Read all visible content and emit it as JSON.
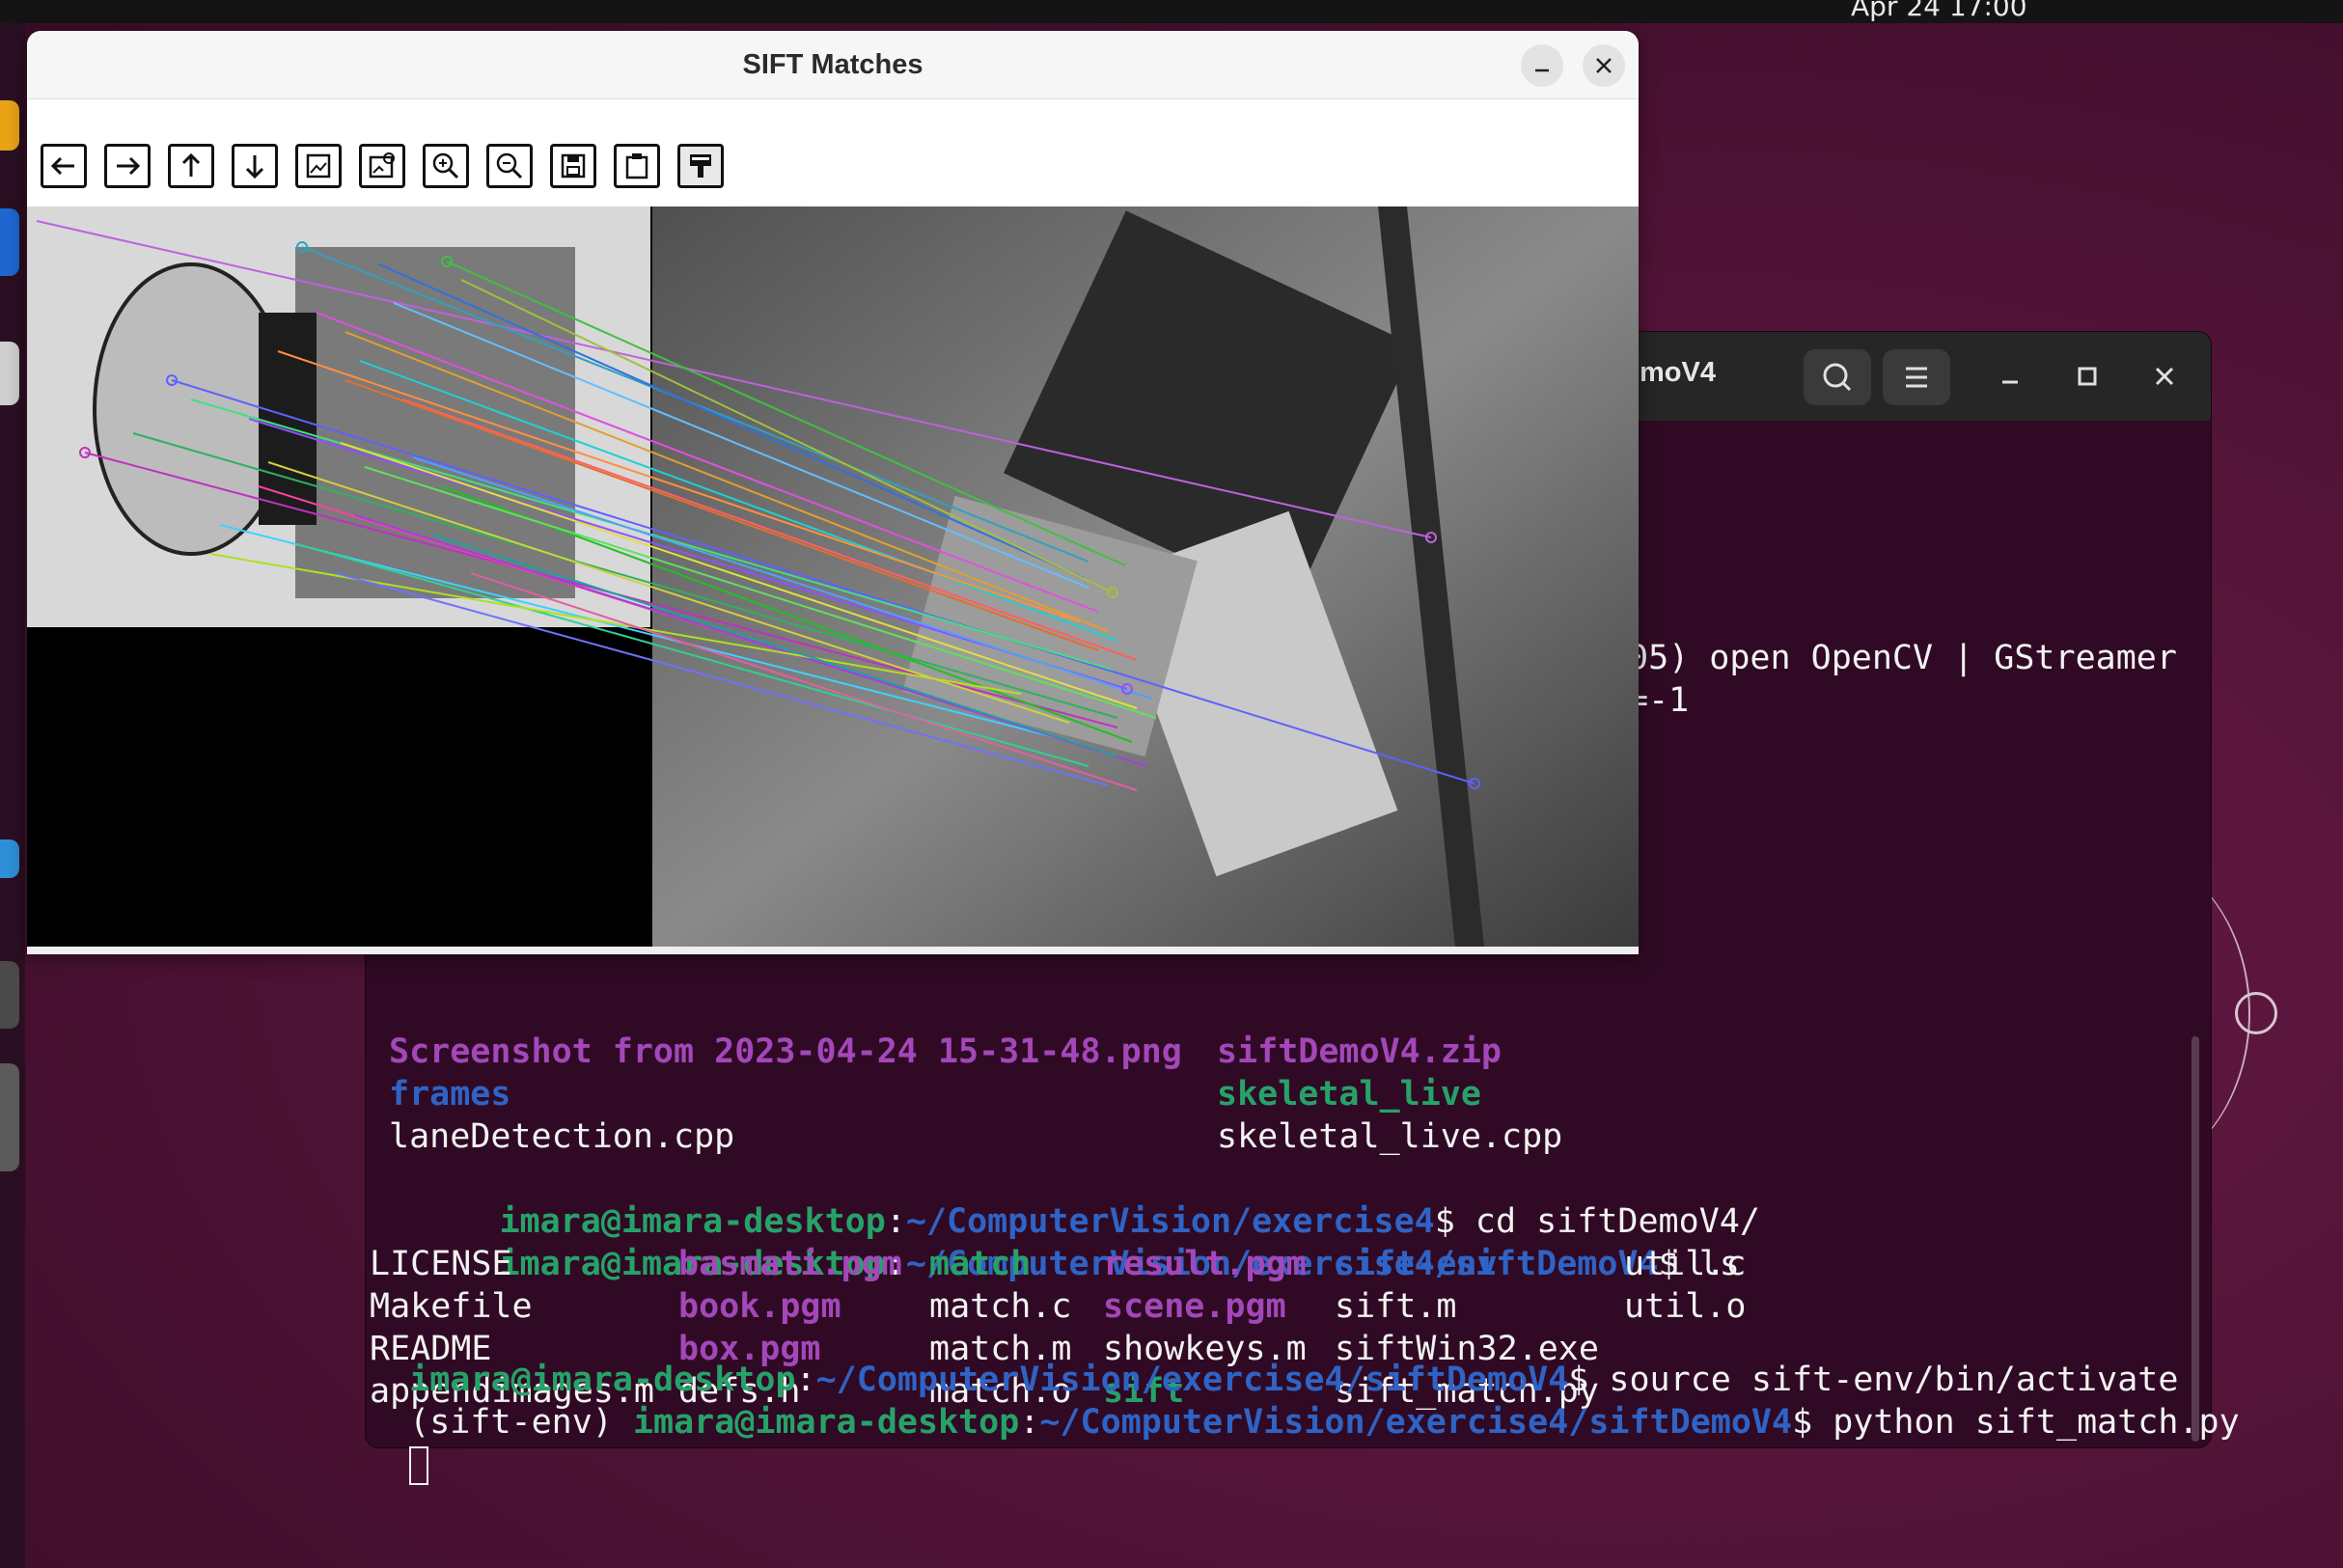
{
  "topbar": {
    "clock": "Apr 24  17:00"
  },
  "terminal": {
    "title": "moV4",
    "search_icon": "search-icon",
    "menu_icon": "hamburger-menu-icon",
    "output_line1": "05) open OpenCV | GStreamer",
    "output_line2": "=-1",
    "partial_row": {
      "c1": "Screenshot from 2023-04-24 15-31-48.png",
      "c2": "siftDemoV4.zip"
    },
    "row_frames": {
      "c1": "frames",
      "c2": "skeletal_live"
    },
    "row_lane": {
      "c1": "laneDetection.cpp",
      "c2": "skeletal_live.cpp"
    },
    "prompt_user": "imara@imara-desktop",
    "path1": "~/ComputerVision/exercise4",
    "cmd1": "$ cd siftDemoV4/",
    "path2": "~/ComputerVision/exercise4/siftDemoV4",
    "cmd2": "$ ls",
    "ls": {
      "r1": [
        "LICENSE",
        "basmati.pgm",
        "match",
        "result.pgm",
        "sift-env",
        "util.c"
      ],
      "r2": [
        "Makefile",
        "book.pgm",
        "match.c",
        "scene.pgm",
        "sift.m",
        "util.o"
      ],
      "r3": [
        "README",
        "box.pgm",
        "match.m",
        "showkeys.m",
        "siftWin32.exe",
        ""
      ],
      "r4": [
        "appendimages.m",
        "defs.h",
        "match.o",
        "sift",
        "sift_match.py",
        ""
      ]
    },
    "cmd3": "$ source sift-env/bin/activate",
    "venv": "(sift-env) ",
    "cmd4": "$ python sift_match.py",
    "colon": ":"
  },
  "sift_window": {
    "title": "SIFT Matches",
    "toolbar_icons": [
      "pan-left-icon",
      "pan-right-icon",
      "pan-up-icon",
      "pan-down-icon",
      "zoom-fit-icon",
      "zoom-original-icon",
      "zoom-in-icon",
      "zoom-out-icon",
      "save-icon",
      "copy-to-clipboard-icon",
      "properties-icon"
    ]
  },
  "colors": {
    "terminal_bg": "#300a24",
    "green": "#26a269",
    "blue": "#2f63c5",
    "purple": "#a347ba"
  }
}
